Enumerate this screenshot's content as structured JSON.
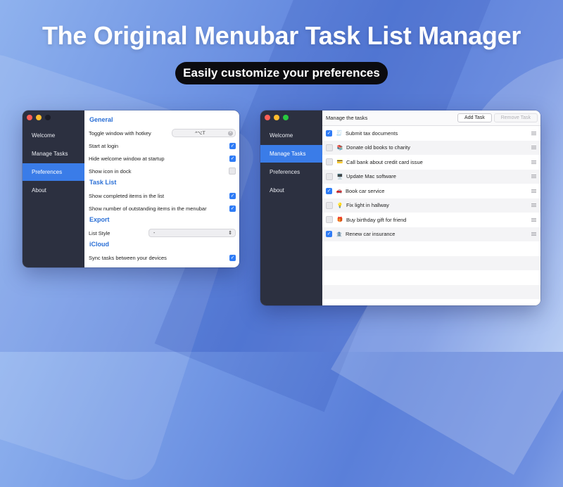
{
  "headline": "The Original Menubar Task List Manager",
  "subheadline": "Easily customize your preferences",
  "prefs_window": {
    "sidebar": [
      "Welcome",
      "Manage Tasks",
      "Preferences",
      "About"
    ],
    "active": "Preferences",
    "sections": {
      "general": {
        "title": "General",
        "toggle_hotkey_label": "Toggle window with hotkey",
        "hotkey_value": "^⌥T",
        "start_at_login": "Start at login",
        "hide_welcome": "Hide welcome window at startup",
        "show_icon_dock": "Show icon in dock"
      },
      "task_list": {
        "title": "Task List",
        "show_completed": "Show completed items in the list",
        "show_outstanding": "Show number of outstanding items in the menubar"
      },
      "export": {
        "title": "Export",
        "list_style_label": "List Style",
        "list_style_value": "-"
      },
      "icloud": {
        "title": "iCloud",
        "sync": "Sync tasks between your devices"
      }
    }
  },
  "tasks_window": {
    "sidebar": [
      "Welcome",
      "Manage Tasks",
      "Preferences",
      "About"
    ],
    "active": "Manage Tasks",
    "header_title": "Manage the tasks",
    "add_button": "Add Task",
    "remove_button": "Remove Task",
    "tasks": [
      {
        "emoji": "🧾",
        "label": "Submit tax documents",
        "checked": true
      },
      {
        "emoji": "📚",
        "label": "Donate old books to charity",
        "checked": false
      },
      {
        "emoji": "💳",
        "label": "Call bank about credit card issue",
        "checked": false
      },
      {
        "emoji": "🖥️",
        "label": "Update Mac software",
        "checked": false
      },
      {
        "emoji": "🚗",
        "label": "Book car service",
        "checked": true
      },
      {
        "emoji": "💡",
        "label": "Fix light in hallway",
        "checked": false
      },
      {
        "emoji": "🎁",
        "label": "Buy birthday gift for friend",
        "checked": false
      },
      {
        "emoji": "🏦",
        "label": "Renew car insurance",
        "checked": true
      }
    ]
  },
  "colors": {
    "sidebar": "#2c3040",
    "accent": "#3a7ce8",
    "section_title": "#2a6fd6"
  }
}
